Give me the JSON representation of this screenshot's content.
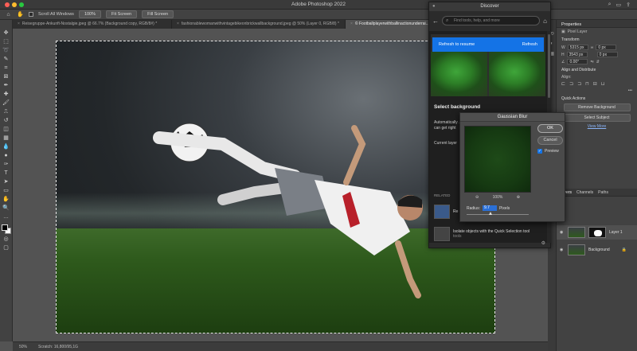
{
  "app": {
    "title": "Adobe Photoshop 2022"
  },
  "options_bar": {
    "scroll_all_label": "Scroll All Windows",
    "zoom_100_label": "100%",
    "fit_screen_label": "Fit Screen",
    "fill_screen_label": "Fill Screen"
  },
  "tabs": [
    {
      "label": "Reisegruppe-Ankunft-Nostalgie.jpeg @ 66.7% (Background copy, RGB/8#) *"
    },
    {
      "label": "fashionablewomanwithvintagebikeonbrickwallbackground.jpeg @ 50% (Layer 0, RGB/8) *"
    },
    {
      "label": "© Footballplayerwithballinactionunderrai..."
    }
  ],
  "status": {
    "zoom": "50%",
    "doc": "Scratch: 16,800/95,1G"
  },
  "discover": {
    "title": "Discover",
    "search_placeholder": "Find tools, help, and more",
    "refresh_text": "Refresh to resume",
    "refresh_button": "Refresh",
    "heading": "Select background",
    "body1": "Automatically ... can get right",
    "body2": "Current layer",
    "related_label": "RELATED",
    "related_item1": "Re",
    "related_item2": "Isolate objects with the Quick Selection tool",
    "related_item2_sub": "tools"
  },
  "gaussian_blur": {
    "title": "Gaussian Blur",
    "ok_label": "OK",
    "cancel_label": "Cancel",
    "preview_label": "Preview",
    "zoom_label": "100%",
    "radius_label": "Radius:",
    "radius_value": "9.7",
    "radius_unit": "Pixels"
  },
  "properties": {
    "title": "Properties",
    "layer_type": "Pixel Layer",
    "transform_label": "Transform",
    "w_label": "W",
    "w_value": "5315 px",
    "h_label": "H",
    "h_value": "3543 px",
    "x_value": "0 px",
    "y_value": "0 px",
    "angle_value": "0.00°",
    "align_label": "Align and Distribute",
    "align_sub": "Align:",
    "quick_actions_label": "Quick Actions",
    "remove_bg_label": "Remove Background",
    "select_subject_label": "Select Subject",
    "view_more_label": "View More"
  },
  "layers": {
    "tab_layers": "Layers",
    "tab_channels": "Channels",
    "tab_paths": "Paths",
    "items": [
      {
        "name": "Layer 1"
      },
      {
        "name": "Background"
      }
    ]
  }
}
